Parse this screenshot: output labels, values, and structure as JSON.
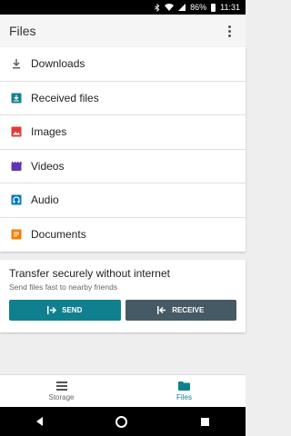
{
  "status": {
    "battery": "86%",
    "time": "11:31"
  },
  "appbar": {
    "title": "Files"
  },
  "list": {
    "items": [
      {
        "label": "Downloads",
        "icon": "download-icon",
        "color": "#616161"
      },
      {
        "label": "Received files",
        "icon": "received-icon",
        "color": "#11808e"
      },
      {
        "label": "Images",
        "icon": "image-icon",
        "color": "#e53935"
      },
      {
        "label": "Videos",
        "icon": "video-icon",
        "color": "#5e35b1"
      },
      {
        "label": "Audio",
        "icon": "audio-icon",
        "color": "#0277bd"
      },
      {
        "label": "Documents",
        "icon": "document-icon",
        "color": "#f57c00"
      }
    ]
  },
  "transfer": {
    "title": "Transfer securely without internet",
    "subtitle": "Send files fast to nearby friends",
    "send_label": "SEND",
    "receive_label": "RECEIVE"
  },
  "nav": {
    "storage_label": "Storage",
    "files_label": "Files"
  },
  "colors": {
    "accent": "#11808e"
  }
}
